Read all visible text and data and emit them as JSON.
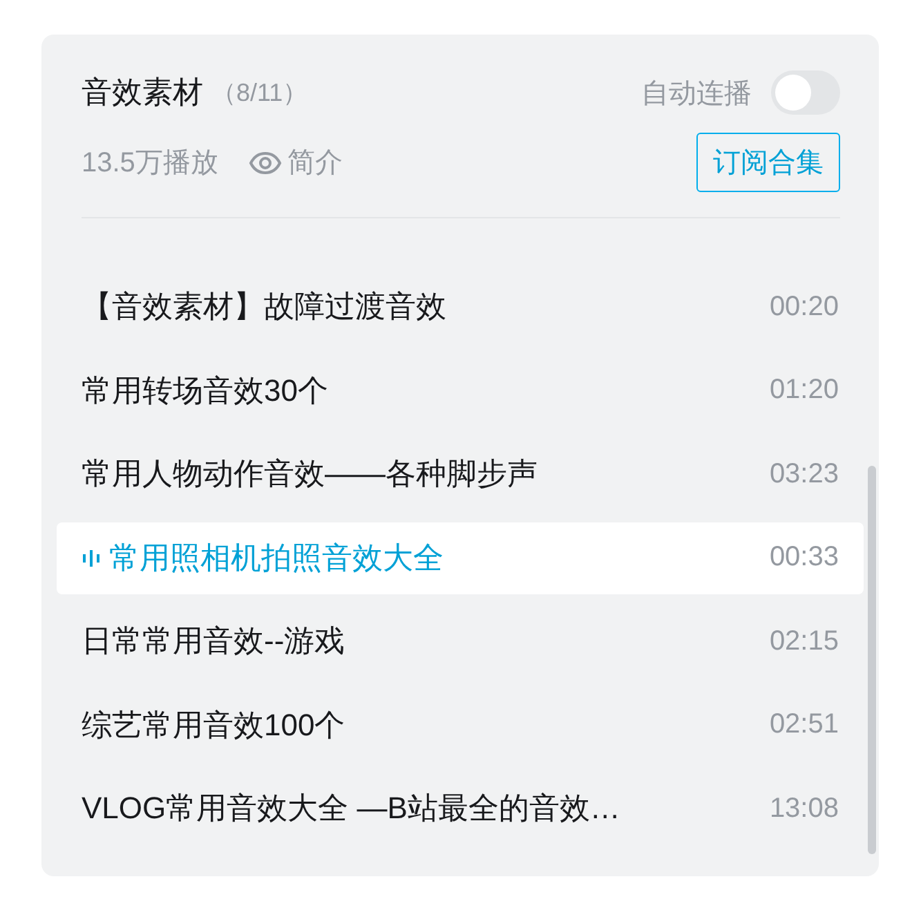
{
  "collection": {
    "title": "音效素材",
    "progress": "（8/11）",
    "autoplay": {
      "label": "自动连播",
      "on": false
    },
    "plays": "13.5万播放",
    "intro": "简介",
    "subscribe": "订阅合集"
  },
  "episodes": [
    {
      "title": "【音效素材】故障过渡音效",
      "duration": "00:20",
      "selected": false
    },
    {
      "title": "常用转场音效30个",
      "duration": "01:20",
      "selected": false
    },
    {
      "title": "常用人物动作音效——各种脚步声",
      "duration": "03:23",
      "selected": false
    },
    {
      "title": "常用照相机拍照音效大全",
      "duration": "00:33",
      "selected": true
    },
    {
      "title": "日常常用音效--游戏",
      "duration": "02:15",
      "selected": false
    },
    {
      "title": "综艺常用音效100个",
      "duration": "02:51",
      "selected": false
    },
    {
      "title": "VLOG常用音效大全 —B站最全的音效…",
      "duration": "13:08",
      "selected": false
    }
  ]
}
